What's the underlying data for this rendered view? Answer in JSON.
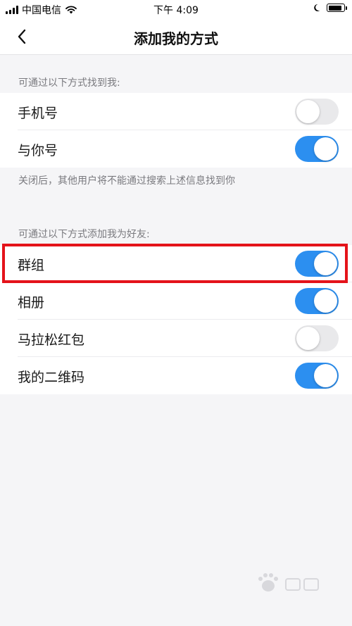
{
  "status_bar": {
    "carrier": "中国电信",
    "time": "下午 4:09",
    "icons": [
      "signal-icon",
      "wifi-icon",
      "moon-icon",
      "battery-icon"
    ]
  },
  "nav": {
    "title": "添加我的方式",
    "back_icon": "chevron-left-icon"
  },
  "find_section": {
    "header": "可通过以下方式找到我:",
    "items": [
      {
        "label": "手机号",
        "enabled": false
      },
      {
        "label": "与你号",
        "enabled": true
      }
    ],
    "note": "关闭后，其他用户将不能通过搜索上述信息找到你"
  },
  "add_section": {
    "header": "可通过以下方式添加我为好友:",
    "items": [
      {
        "label": "群组",
        "enabled": true,
        "highlighted": true
      },
      {
        "label": "相册",
        "enabled": true
      },
      {
        "label": "马拉松红包",
        "enabled": false
      },
      {
        "label": "我的二维码",
        "enabled": true
      }
    ]
  },
  "colors": {
    "toggle_on": "#2c8ff0",
    "toggle_off": "#e9e9eb",
    "highlight": "#e4131a",
    "background": "#f5f5f7"
  },
  "watermark": {
    "icon": "baidu-jingyan-watermark"
  }
}
